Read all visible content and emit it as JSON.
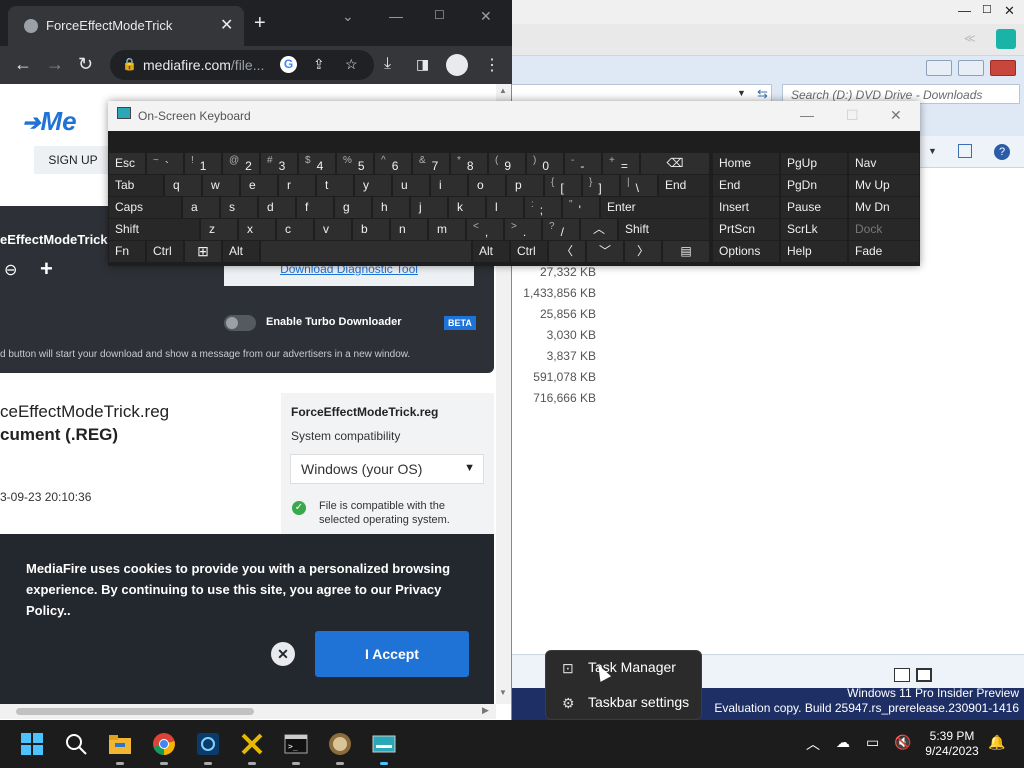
{
  "chrome": {
    "tab_title": "ForceEffectModeTrick",
    "url_host": "mediafire.com",
    "url_path": "/file..."
  },
  "mediafire": {
    "logo_text": "Me",
    "signup": "SIGN UP",
    "file_short": "eEffectModeTrick",
    "diag_tool": "Download Diagnostic Tool",
    "turbo": "Enable Turbo Downloader",
    "beta": "BETA",
    "notice": "d button will start your download and show a message from our advertisers in a new window.",
    "file_name": "ceEffectModeTrick.reg",
    "doc_type": "cument (.REG)",
    "date": "3-09-23 20:10:36",
    "sidebar_name": "ForceEffectModeTrick.reg",
    "compat_label": "System compatibility",
    "os_select": "Windows (your OS)",
    "compat_note": "File is compatible with the selected operating system."
  },
  "cookie": {
    "message": "MediaFire uses cookies to provide you with a personalized browsing experience. By continuing to use this site, you agree to our Privacy Policy..",
    "accept": "I Accept"
  },
  "osk": {
    "title": "On-Screen Keyboard",
    "keys": {
      "esc": "Esc",
      "tab": "Tab",
      "caps": "Caps",
      "shift": "Shift",
      "fn": "Fn",
      "ctrl": "Ctrl",
      "alt": "Alt",
      "end": "End",
      "enter": "Enter",
      "altgr": "Alt",
      "ctrl_r": "Ctrl",
      "shift_r": "Shift",
      "home": "Home",
      "pgup": "PgUp",
      "nav": "Nav",
      "kend": "End",
      "pgdn": "PgDn",
      "mvup": "Mv Up",
      "insert": "Insert",
      "pause": "Pause",
      "mvdn": "Mv Dn",
      "prtscn": "PrtScn",
      "scrlk": "ScrLk",
      "dock": "Dock",
      "options": "Options",
      "help": "Help",
      "fade": "Fade",
      "q": "q",
      "w": "w",
      "e": "e",
      "r": "r",
      "t": "t",
      "y": "y",
      "u": "u",
      "i": "i",
      "o": "o",
      "p": "p",
      "a": "a",
      "s": "s",
      "d": "d",
      "f": "f",
      "g": "g",
      "h": "h",
      "j": "j",
      "k": "k",
      "l": "l",
      "z": "z",
      "x": "x",
      "c": "c",
      "v": "v",
      "b": "b",
      "n": "n",
      "m": "m",
      "d1": "1",
      "d2": "2",
      "d3": "3",
      "d4": "4",
      "d5": "5",
      "d6": "6",
      "d7": "7",
      "d8": "8",
      "d9": "9",
      "d0": "0",
      "s1": "!",
      "s2": "@",
      "s3": "#",
      "s4": "$",
      "s5": "%",
      "s6": "^",
      "s7": "&",
      "s8": "*",
      "s9": "(",
      "s0": ")",
      "tilde": "~",
      "grave": "`",
      "minus_top": "-",
      "minus": "-",
      "plus": "+",
      "equals": "=",
      "lbrace": "{",
      "lbracket": "[",
      "rbrace": "}",
      "rbracket": "]",
      "pipe": "|",
      "backslash": "\\",
      "colon": ":",
      "semicolon": ";",
      "dquote": "\"",
      "squote": "'",
      "lt": "<",
      "comma": ",",
      "gt": ">",
      "period": ".",
      "question": "?",
      "slash": "/"
    }
  },
  "explorer": {
    "search_placeholder": "Search (D:) DVD Drive - Downloads",
    "sizes": [
      "27,332 KB",
      "1,433,856 KB",
      "25,856 KB",
      "3,030 KB",
      "3,837 KB",
      "591,078 KB",
      "716,666 KB"
    ]
  },
  "context_menu": {
    "task_manager": "Task Manager",
    "taskbar_settings": "Taskbar settings"
  },
  "watermark": {
    "line1": "Windows 11 Pro Insider Preview",
    "line2": "Evaluation copy. Build 25947.rs_prerelease.230901-1416"
  },
  "taskbar": {
    "time": "5:39 PM",
    "date": "9/24/2023"
  }
}
